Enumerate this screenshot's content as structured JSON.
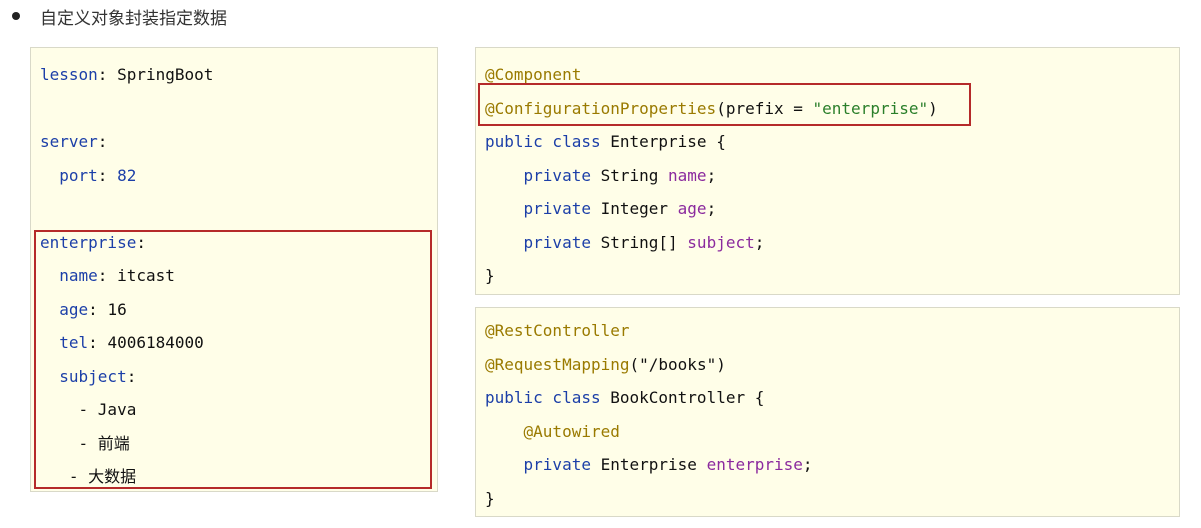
{
  "heading": {
    "text": "自定义对象封装指定数据"
  },
  "yaml": {
    "lines": [
      [
        {
          "t": "lesson",
          "c": "k"
        },
        {
          "t": ": ",
          "c": "p"
        },
        {
          "t": "SpringBoot",
          "c": "v"
        }
      ],
      [],
      [
        {
          "t": "server",
          "c": "k"
        },
        {
          "t": ":",
          "c": "p"
        }
      ],
      [
        {
          "t": "  ",
          "c": "p"
        },
        {
          "t": "port",
          "c": "k"
        },
        {
          "t": ": ",
          "c": "p"
        },
        {
          "t": "82",
          "c": "num"
        }
      ],
      [],
      [
        {
          "t": "enterprise",
          "c": "k"
        },
        {
          "t": ":",
          "c": "p"
        }
      ],
      [
        {
          "t": "  ",
          "c": "p"
        },
        {
          "t": "name",
          "c": "k"
        },
        {
          "t": ": ",
          "c": "p"
        },
        {
          "t": "itcast",
          "c": "v"
        }
      ],
      [
        {
          "t": "  ",
          "c": "p"
        },
        {
          "t": "age",
          "c": "k"
        },
        {
          "t": ": ",
          "c": "p"
        },
        {
          "t": "16",
          "c": "v"
        }
      ],
      [
        {
          "t": "  ",
          "c": "p"
        },
        {
          "t": "tel",
          "c": "k"
        },
        {
          "t": ": ",
          "c": "p"
        },
        {
          "t": "4006184000",
          "c": "v"
        }
      ],
      [
        {
          "t": "  ",
          "c": "p"
        },
        {
          "t": "subject",
          "c": "k"
        },
        {
          "t": ":",
          "c": "p"
        }
      ],
      [
        {
          "t": "    - ",
          "c": "p"
        },
        {
          "t": "Java",
          "c": "v"
        }
      ],
      [
        {
          "t": "    - ",
          "c": "p"
        },
        {
          "t": "前端",
          "c": "v"
        }
      ],
      [
        {
          "t": "   - ",
          "c": "p"
        },
        {
          "t": "大数据",
          "c": "v"
        }
      ]
    ]
  },
  "enterprise_class": {
    "lines": [
      [
        {
          "t": "@Component",
          "c": "ann"
        }
      ],
      [
        {
          "t": "@ConfigurationProperties",
          "c": "ann"
        },
        {
          "t": "(prefix = ",
          "c": "p"
        },
        {
          "t": "\"enterprise\"",
          "c": "str"
        },
        {
          "t": ")",
          "c": "p"
        }
      ],
      [
        {
          "t": "public class ",
          "c": "kw"
        },
        {
          "t": "Enterprise {",
          "c": "p"
        }
      ],
      [
        {
          "t": "    private ",
          "c": "kw"
        },
        {
          "t": "String ",
          "c": "p"
        },
        {
          "t": "name",
          "c": "fld"
        },
        {
          "t": ";",
          "c": "p"
        }
      ],
      [
        {
          "t": "    private ",
          "c": "kw"
        },
        {
          "t": "Integer ",
          "c": "p"
        },
        {
          "t": "age",
          "c": "fld"
        },
        {
          "t": ";",
          "c": "p"
        }
      ],
      [
        {
          "t": "    private ",
          "c": "kw"
        },
        {
          "t": "String[] ",
          "c": "p"
        },
        {
          "t": "subject",
          "c": "fld"
        },
        {
          "t": ";",
          "c": "p"
        }
      ],
      [
        {
          "t": "}",
          "c": "p"
        }
      ]
    ]
  },
  "controller_class": {
    "lines": [
      [
        {
          "t": "@RestController",
          "c": "ann"
        }
      ],
      [
        {
          "t": "@RequestMapping",
          "c": "ann"
        },
        {
          "t": "(",
          "c": "p"
        },
        {
          "t": "\"/books\"",
          "c": "p"
        },
        {
          "t": ")",
          "c": "p"
        }
      ],
      [
        {
          "t": "public class ",
          "c": "kw"
        },
        {
          "t": "BookController {",
          "c": "p"
        }
      ],
      [
        {
          "t": "    ",
          "c": "p"
        },
        {
          "t": "@Autowired",
          "c": "ann"
        }
      ],
      [
        {
          "t": "    private ",
          "c": "kw"
        },
        {
          "t": "Enterprise ",
          "c": "p"
        },
        {
          "t": "enterprise",
          "c": "fld"
        },
        {
          "t": ";",
          "c": "p"
        }
      ],
      [
        {
          "t": "}",
          "c": "p"
        }
      ]
    ]
  },
  "colors": {
    "panel_background": "#fffee8",
    "highlight_border": "#b52a2a",
    "key": "#1c3fa8",
    "annotation": "#9a7a00",
    "string": "#2a7f2a",
    "field": "#8b2a9e"
  }
}
